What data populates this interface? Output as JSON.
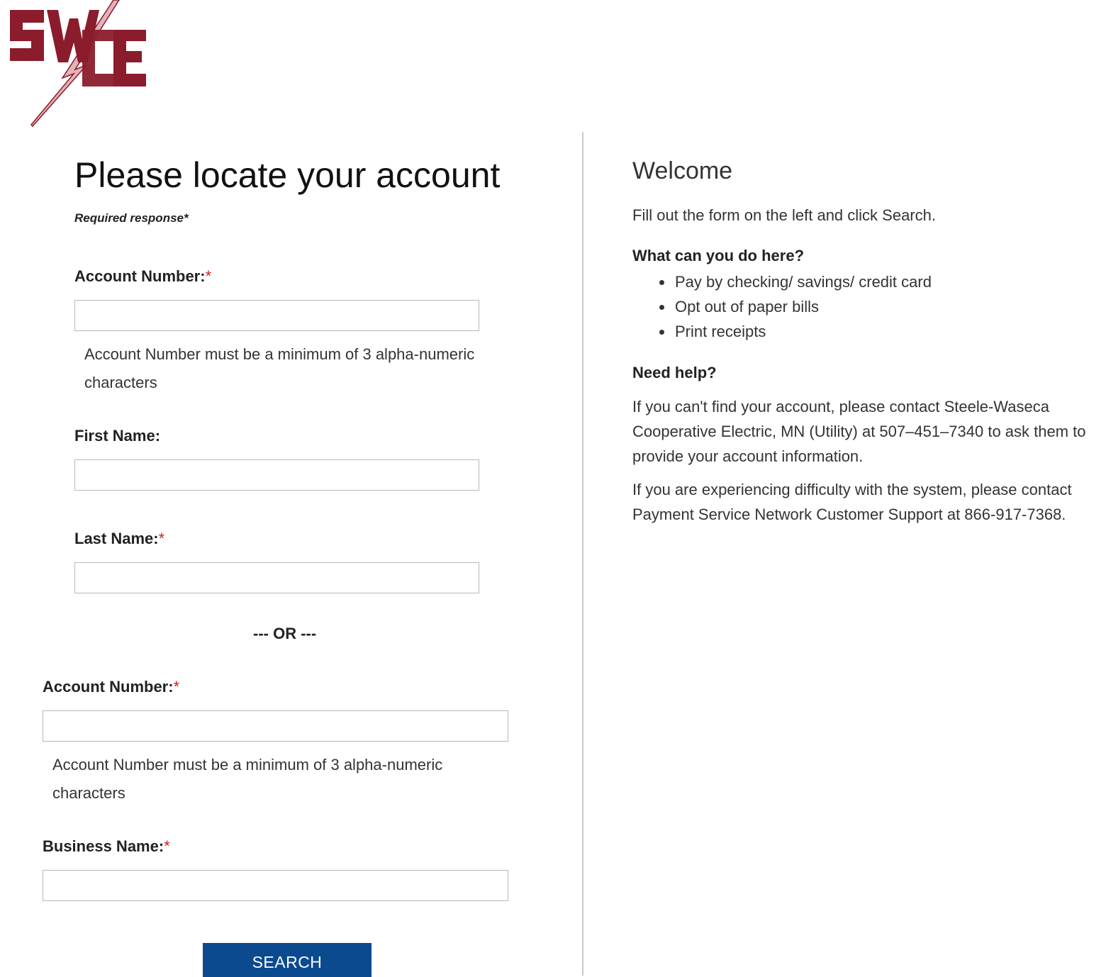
{
  "logo": {
    "text": "SWCE"
  },
  "form": {
    "title": "Please locate your account",
    "required_note": "Required response*",
    "group1": {
      "account_label": "Account Number:",
      "account_hint": "Account Number must be a minimum of 3 alpha-numeric characters",
      "first_name_label": "First Name:",
      "last_name_label": "Last Name:"
    },
    "separator": "--- OR ---",
    "group2": {
      "account_label": "Account Number:",
      "account_hint": "Account Number must be a minimum of 3 alpha-numeric characters",
      "business_label": "Business Name:"
    },
    "required_marker": "*",
    "search_label": "SEARCH"
  },
  "help": {
    "title": "Welcome",
    "intro": "Fill out the form on the left and click Search.",
    "what_heading": "What can you do here?",
    "items": [
      "Pay by checking/ savings/ credit card",
      "Opt out of paper bills",
      "Print receipts"
    ],
    "need_heading": "Need help?",
    "contact_utility": "If you can't find your account, please contact Steele-Waseca Cooperative Electric, MN (Utility) at 507–451–7340 to ask them to provide your account information.",
    "contact_support": "If you are experiencing difficulty with the system, please contact Payment Service Network Customer Support at 866-917-7368."
  },
  "colors": {
    "brand": "#8b1c2c",
    "button": "#0b4a8f",
    "required": "#d21f1f"
  }
}
